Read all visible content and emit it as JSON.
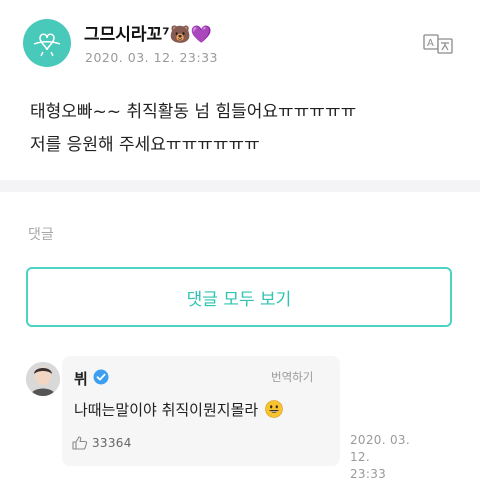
{
  "post": {
    "author": "그므시라꼬⁷🐻💜",
    "date": "2020. 03. 12. 23:33",
    "body_lines": [
      "태형오빠~~ 취직활동 넘 힘들어요ㅠㅠㅠㅠㅠ",
      "저를 응원해 주세요ㅠㅠㅠㅠㅠㅠ"
    ],
    "translate_icon": "translate-icon"
  },
  "comments_section": {
    "label": "댓글",
    "view_all_label": "댓글 모두 보기"
  },
  "comment": {
    "author": "뷔",
    "verified_icon": "verified-badge-icon",
    "translate_label": "번역하기",
    "text": "나때는말이야 취직이뭔지몰라",
    "emoji": "smiley-emoji",
    "like_icon": "thumbs-up-icon",
    "likes": "33364",
    "date_line1": "2020. 03. 12.",
    "date_line2": "23:33"
  },
  "colors": {
    "accent": "#2fc3b1",
    "accent_border": "#4cd3c2",
    "avatar_bg": "#49c9b9",
    "verified": "#3a9ff0",
    "muted_text": "#9a9a9a"
  }
}
